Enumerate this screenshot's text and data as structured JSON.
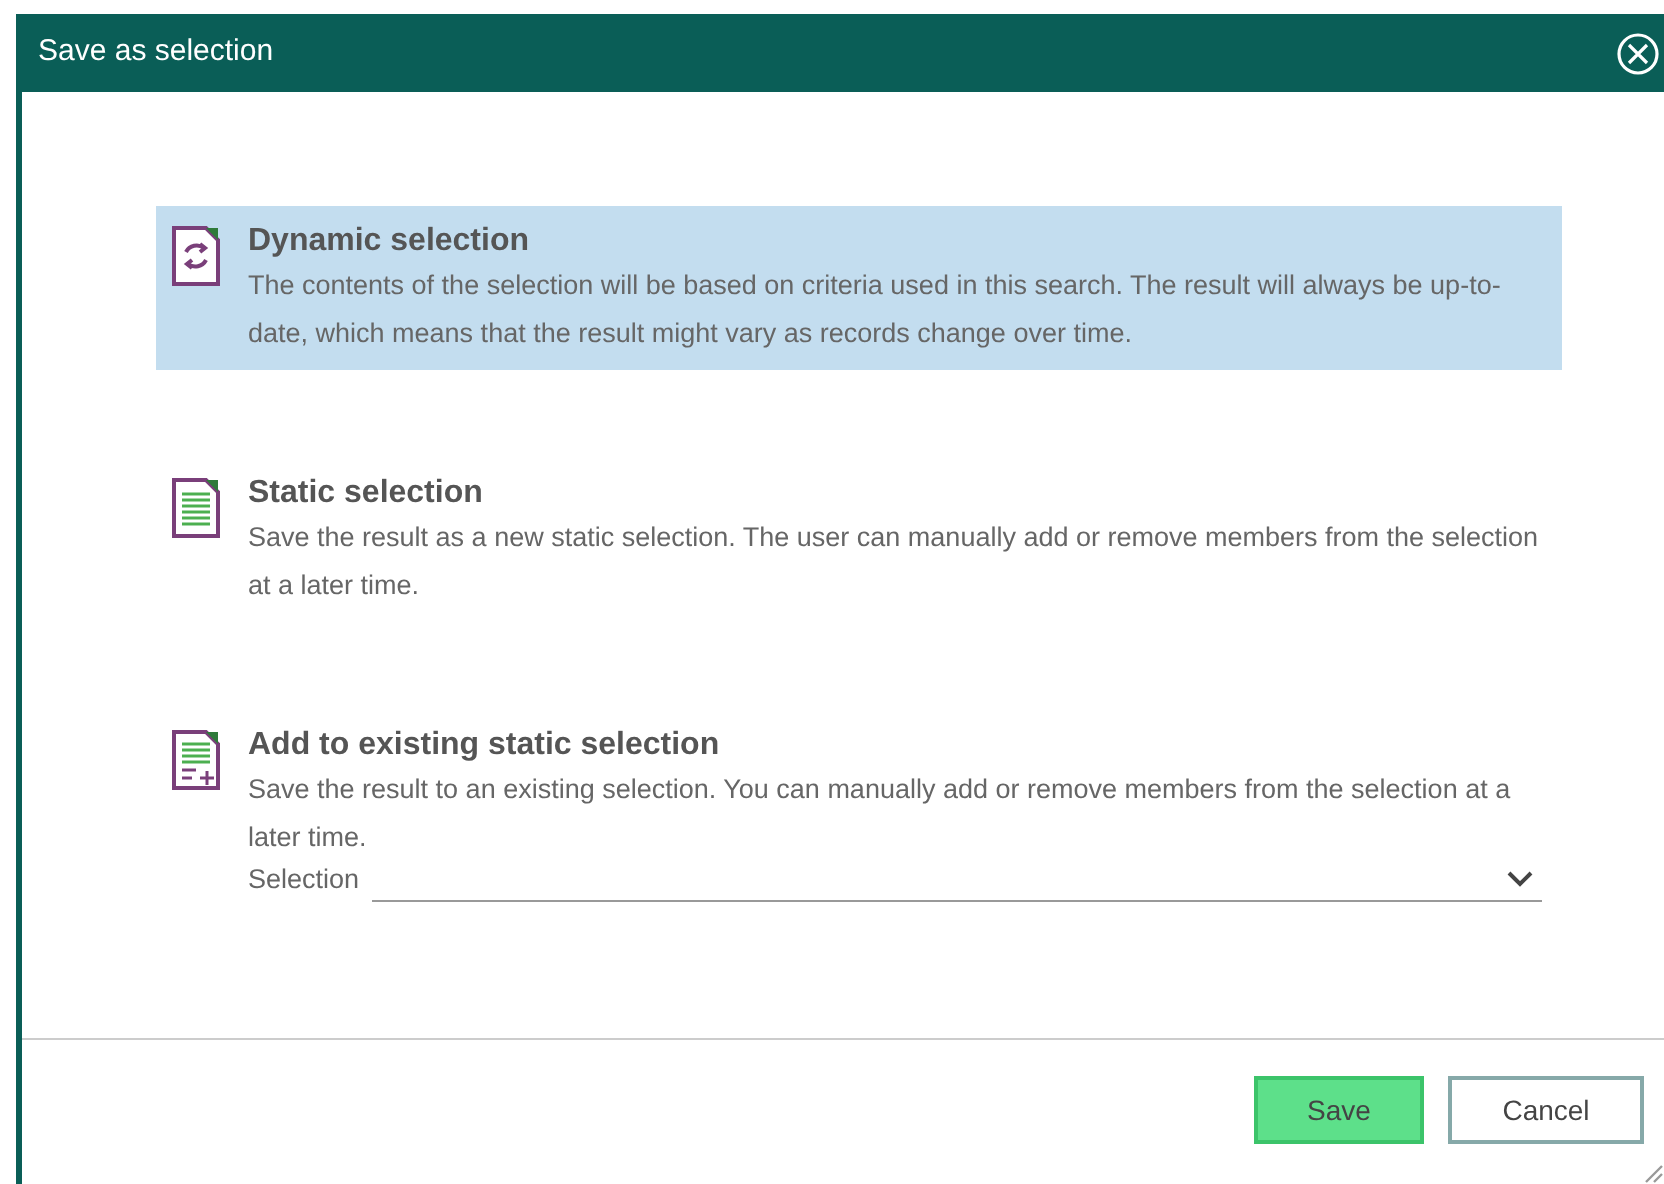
{
  "dialog": {
    "title": "Save as selection"
  },
  "options": [
    {
      "kind": "dynamic",
      "title": "Dynamic selection",
      "description": "The contents of the selection will be based on criteria used in this search. The result will always be up-to-date, which means that the result might vary as records change over time.",
      "selected": true
    },
    {
      "kind": "static",
      "title": "Static selection",
      "description": "Save the result as a new static selection. The user can manually add or remove members from the selection at a later time.",
      "selected": false
    },
    {
      "kind": "add",
      "title": "Add to existing static selection",
      "description": "Save the result to an existing selection. You can manually add or remove members from the selection at a later time.",
      "selected": false,
      "field": {
        "label": "Selection"
      }
    }
  ],
  "buttons": [
    {
      "kind": "primary",
      "label": "Save"
    },
    {
      "kind": "secondary",
      "label": "Cancel"
    }
  ]
}
